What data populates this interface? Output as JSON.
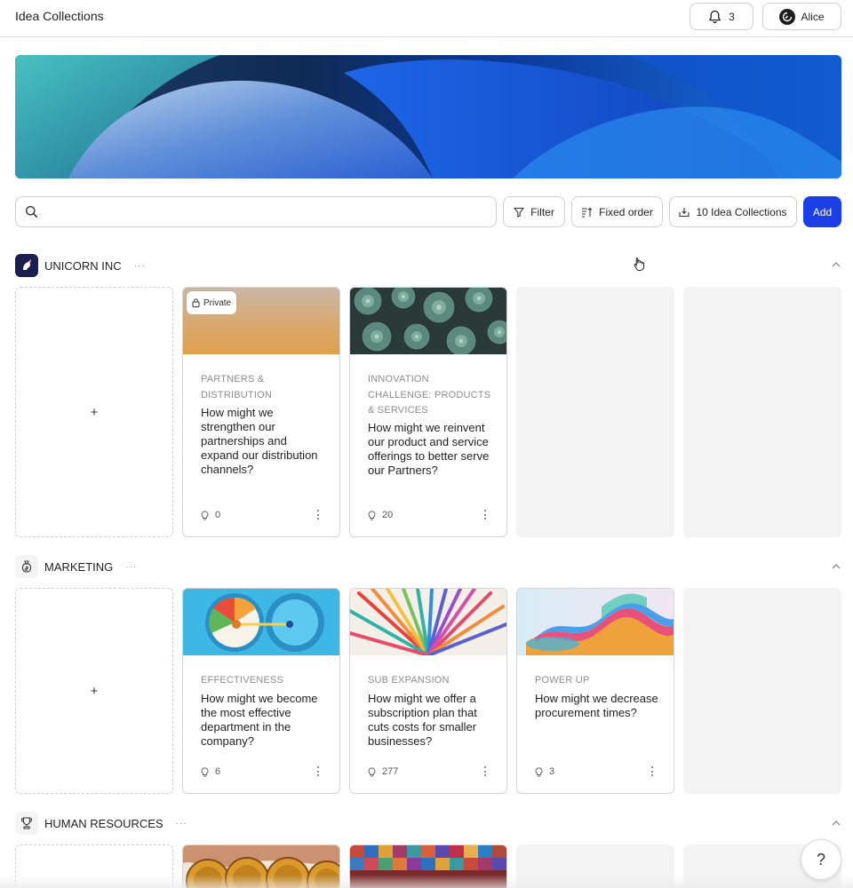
{
  "app": {
    "title": "Idea Collections"
  },
  "header": {
    "notifications": {
      "icon": "bell-icon",
      "count": "3"
    },
    "user": {
      "name": "Alice",
      "icon": "avatar-icon"
    }
  },
  "toolbar": {
    "search_placeholder": "",
    "filter_label": "Filter",
    "order_label": "Fixed order",
    "count_label": "10 Idea Collections",
    "add_label": "Add"
  },
  "colors": {
    "accent": "#1b3fe6",
    "placeholder": "#f3f3f3"
  },
  "add_card_symbol": "+",
  "sections": [
    {
      "title": "UNICORN INC",
      "icon": "unicorn-logo-icon",
      "more": "···",
      "collapse": "^",
      "cards": [
        {
          "badge": "Private",
          "category": "PARTNERS & DISTRIBUTION",
          "question": "How might we strengthen our partnerships and expand our distribution channels?",
          "ideas": "0",
          "image": "sunset-gradient-image"
        },
        {
          "badge": "",
          "category": "INNOVATION CHALLENGE: PRODUCTS & SERVICES",
          "question": "How might we reinvent our product and service offerings to better serve our Partners?",
          "ideas": "20",
          "image": "succulents-image"
        }
      ]
    },
    {
      "title": "MARKETING",
      "icon": "money-bag-icon",
      "more": "···",
      "collapse": "^",
      "cards": [
        {
          "badge": "",
          "category": "EFFECTIVENESS",
          "question": "How might we become the most effective department in the company?",
          "ideas": "6",
          "image": "gauges-image"
        },
        {
          "badge": "",
          "category": "SUB EXPANSION",
          "question": "How might we offer a subscription plan that cuts costs for smaller businesses?",
          "ideas": "277",
          "image": "color-fan-image"
        },
        {
          "badge": "",
          "category": "POWER UP",
          "question": "How might we decrease procurement times?",
          "ideas": "3",
          "image": "wavy-3d-image"
        }
      ]
    },
    {
      "title": "HUMAN RESOURCES",
      "icon": "trophy-icon",
      "more": "···",
      "collapse": "^",
      "cards": [
        {
          "image": "coins-image"
        },
        {
          "image": "portraits-mosaic-image"
        }
      ]
    }
  ],
  "help": {
    "label": "?"
  }
}
